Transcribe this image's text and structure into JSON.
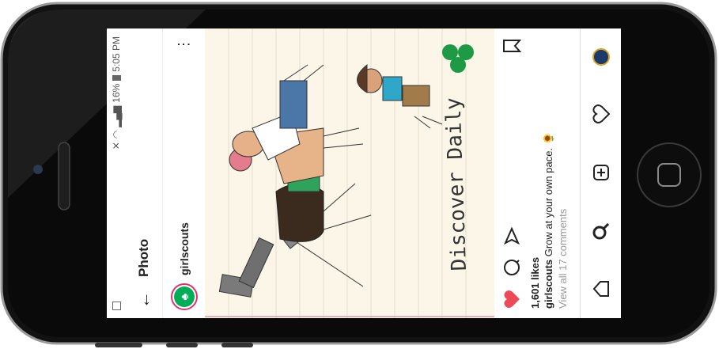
{
  "status_bar": {
    "battery": "16%",
    "time": "5:05 PM"
  },
  "app_bar": {
    "title": "Photo"
  },
  "post": {
    "username": "girlscouts",
    "photo_text": "Discover Daily",
    "likes": "1,601 likes",
    "caption_user": "girlscouts",
    "caption_text": "Grow at your own pace. 🌻",
    "comments_link": "View all 17 comments"
  },
  "colors": {
    "like_red": "#ed4956",
    "brand_green": "#00ae58",
    "phone_body": "#111111"
  },
  "icons": [
    "back-arrow-icon",
    "more-icon",
    "heart-icon",
    "comment-icon",
    "share-icon",
    "bookmark-icon",
    "home-icon",
    "search-icon",
    "add-icon",
    "activity-icon",
    "profile-icon"
  ]
}
